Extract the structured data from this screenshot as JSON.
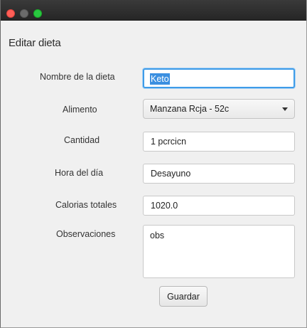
{
  "window": {
    "traffic_lights": {
      "close_color": "#fe5f57",
      "minimize_color": "#6b6b6b",
      "maximize_color": "#29c840"
    }
  },
  "form": {
    "title": "Editar dieta",
    "fields": {
      "nombre": {
        "label": "Nombre de la dieta",
        "value": "Keto"
      },
      "alimento": {
        "label": "Alimento",
        "value": "Manzana Rcja - 52c"
      },
      "cantidad": {
        "label": "Cantidad",
        "value": "1 pcrcicn"
      },
      "hora": {
        "label": "Hora del día",
        "value": "Desayuno"
      },
      "calorias": {
        "label": "Calorias totales",
        "value": "1020.0"
      },
      "observaciones": {
        "label": "Observaciones",
        "value": "obs"
      }
    },
    "save_label": "Guardar"
  },
  "colors": {
    "focus_ring": "#3f9ce8",
    "selection": "#3b8fe0"
  },
  "icons": {
    "combo_arrow": "chevron-down-icon"
  }
}
